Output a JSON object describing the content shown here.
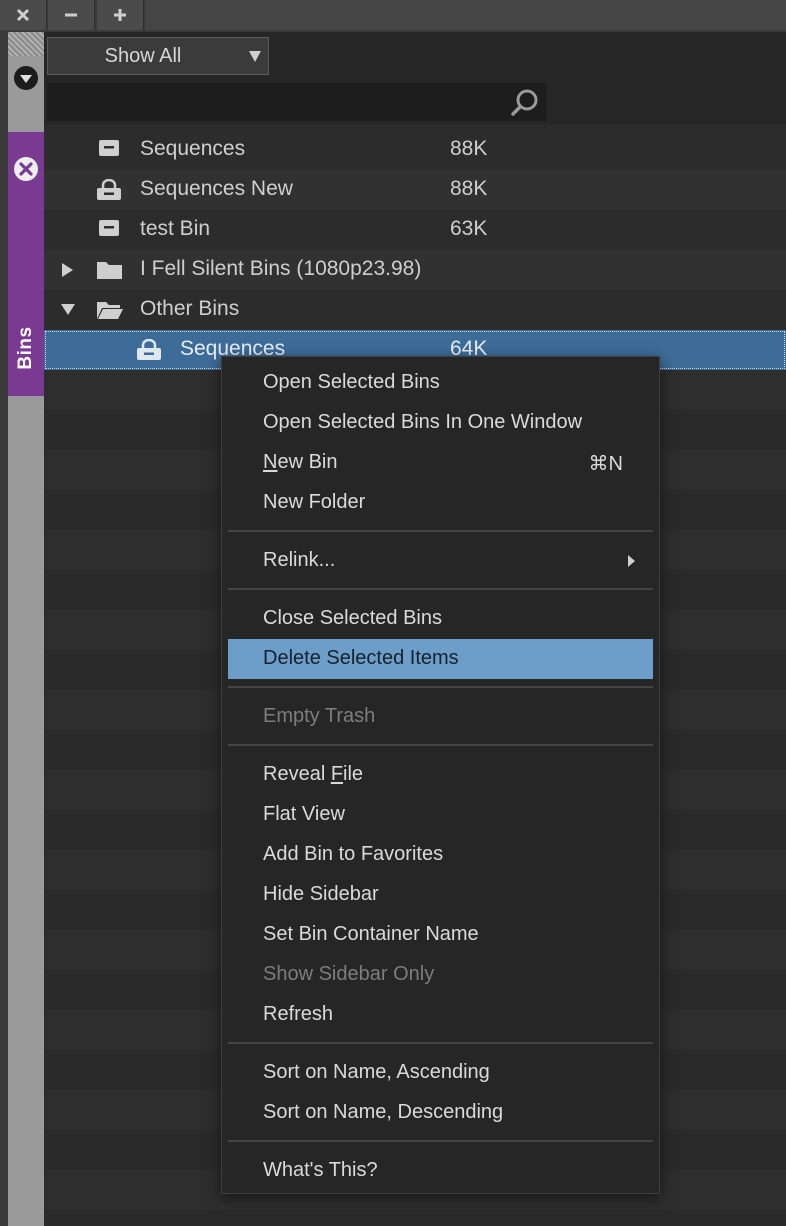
{
  "window": {
    "buttons": [
      {
        "icon": "close-icon"
      },
      {
        "icon": "minimize-icon"
      },
      {
        "icon": "add-icon"
      }
    ]
  },
  "sidebar": {
    "tab_label": "Bins"
  },
  "filter": {
    "selected": "Show All"
  },
  "search": {
    "value": ""
  },
  "bins": [
    {
      "name": "Sequences",
      "size": "88K",
      "icon": "bin-icon"
    },
    {
      "name": "Sequences New",
      "size": "88K",
      "icon": "locked-bin-icon"
    },
    {
      "name": "test Bin",
      "size": "63K",
      "icon": "bin-icon"
    },
    {
      "name": "I Fell Silent Bins (1080p23.98)",
      "size": "",
      "icon": "folder-icon",
      "expanded": false
    },
    {
      "name": "Other Bins",
      "size": "",
      "icon": "folder-open-icon",
      "expanded": true
    },
    {
      "name": "Sequences",
      "size": "64K",
      "icon": "locked-bin-icon",
      "selected": true
    }
  ],
  "context_menu": {
    "items": [
      {
        "label": "Open Selected Bins"
      },
      {
        "label": "Open Selected Bins In One Window"
      },
      {
        "label_pre": "",
        "label_u": "N",
        "label_post": "ew Bin",
        "shortcut": "⌘N"
      },
      {
        "label": "New Folder"
      },
      {
        "label": "Relink..."
      },
      {
        "label": "Close Selected Bins"
      },
      {
        "label": "Delete Selected Items",
        "highlighted": true
      },
      {
        "label": "Empty Trash",
        "disabled": true
      },
      {
        "label_pre": "Reveal ",
        "label_u": "F",
        "label_post": "ile"
      },
      {
        "label": "Flat View"
      },
      {
        "label": "Add Bin to Favorites"
      },
      {
        "label": "Hide Sidebar"
      },
      {
        "label": "Set Bin Container Name"
      },
      {
        "label": "Show Sidebar Only",
        "disabled": true
      },
      {
        "label": "Refresh"
      },
      {
        "label": "Sort on Name, Ascending"
      },
      {
        "label": "Sort on Name, Descending"
      },
      {
        "label": "What's This?"
      }
    ]
  }
}
